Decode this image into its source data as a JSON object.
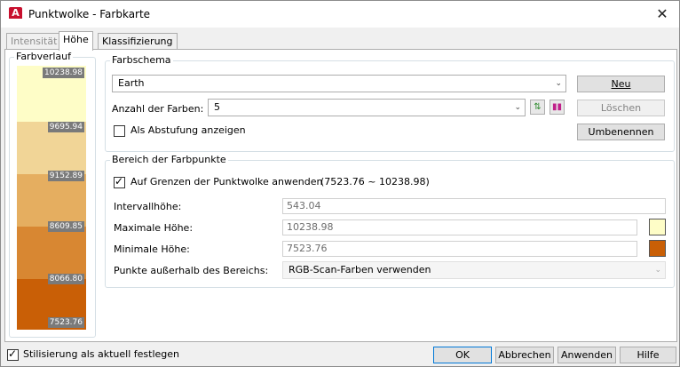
{
  "window": {
    "title": "Punktwolke - Farbkarte",
    "app_icon_letter": "A"
  },
  "tabs": [
    {
      "label": "Intensität"
    },
    {
      "label": "Höhe"
    },
    {
      "label": "Klassifizierung"
    }
  ],
  "gradient": {
    "title": "Farbverlauf",
    "stops": [
      {
        "label": "10238.98",
        "color": "#fefdc7"
      },
      {
        "label": "9695.94",
        "color": "#f1d597"
      },
      {
        "label": "9152.89",
        "color": "#e5ae60"
      },
      {
        "label": "8609.85",
        "color": "#d88732"
      },
      {
        "label": "8066.80",
        "color": "#c95f06"
      },
      {
        "label": "7523.76",
        "color": "#c95f06"
      }
    ]
  },
  "farbschema": {
    "title": "Farbschema",
    "scheme_value": "Earth",
    "count_label": "Anzahl der Farben:",
    "count_value": "5",
    "stepped_label": "Als Abstufung anzeigen",
    "new_button": "Neu",
    "delete_button": "Löschen",
    "rename_button": "Umbenennen"
  },
  "bereich": {
    "title": "Bereich der Farbpunkte",
    "bounds_label": "Auf Grenzen der Punktwolke anwenden",
    "bounds_range": "(7523.76 ~ 10238.98)",
    "interval_label": "Intervallhöhe:",
    "interval_value": "543.04",
    "max_label": "Maximale Höhe:",
    "max_value": "10238.98",
    "max_color": "#fefdc7",
    "min_label": "Minimale Höhe:",
    "min_value": "7523.76",
    "min_color": "#c95f06",
    "outside_label": "Punkte außerhalb des Bereichs:",
    "outside_value": "RGB-Scan-Farben verwenden"
  },
  "footer": {
    "current_label": "Stilisierung als aktuell festlegen",
    "ok": "OK",
    "cancel": "Abbrechen",
    "apply": "Anwenden",
    "help": "Hilfe"
  }
}
